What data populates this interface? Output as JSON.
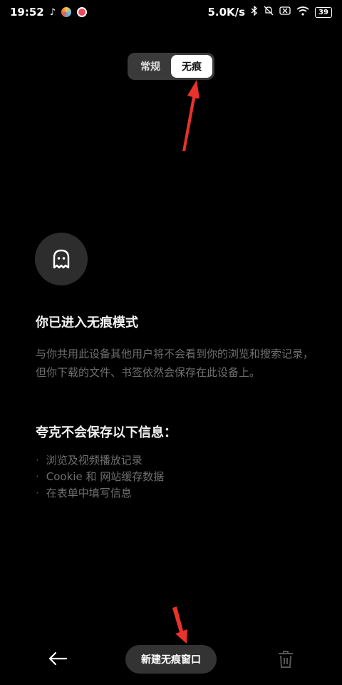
{
  "status_bar": {
    "time": "19:52",
    "network_speed": "5.0K/s",
    "battery": "39",
    "icons": [
      "tiktok-icon",
      "app-icon-1",
      "app-icon-2",
      "bluetooth-icon",
      "mute-icon",
      "sim-off-icon",
      "wifi-icon",
      "battery-icon"
    ]
  },
  "mode_toggle": {
    "normal_label": "常规",
    "incognito_label": "无痕",
    "selected": "无痕"
  },
  "content": {
    "title": "你已进入无痕模式",
    "description": "与你共用此设备其他用户将不会看到你的浏览和搜索记录，但你下载的文件、书签依然会保存在此设备上。",
    "subtitle": "夸克不会保存以下信息：",
    "items": [
      "浏览及视频播放记录",
      "Cookie 和 网站缓存数据",
      "在表单中填写信息"
    ]
  },
  "bottom_bar": {
    "new_window_label": "新建无痕窗口"
  },
  "colors": {
    "background": "#000000",
    "annotation_arrow": "#e8322b"
  }
}
